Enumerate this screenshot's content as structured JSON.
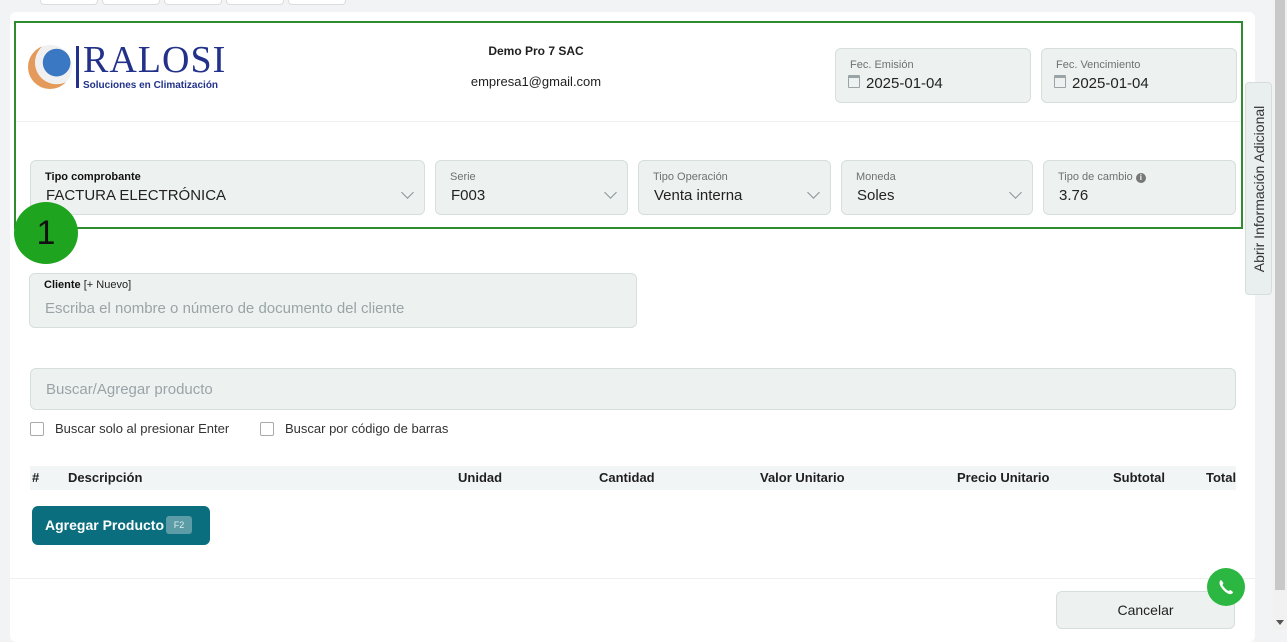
{
  "company": {
    "name": "Demo Pro 7 SAC",
    "email": "empresa1@gmail.com"
  },
  "logo": {
    "name": "RALOSI",
    "tagline": "Soluciones en Climatización"
  },
  "dates": {
    "emission": {
      "label": "Fec. Emisión",
      "value": "2025-01-04"
    },
    "due": {
      "label": "Fec. Vencimiento",
      "value": "2025-01-04"
    }
  },
  "selects": {
    "doc_type": {
      "label": "Tipo comprobante",
      "value": "FACTURA ELECTRÓNICA"
    },
    "series": {
      "label": "Serie",
      "value": "F003"
    },
    "operation": {
      "label": "Tipo Operación",
      "value": "Venta interna"
    },
    "currency": {
      "label": "Moneda",
      "value": "Soles"
    },
    "exchange": {
      "label": "Tipo de cambio",
      "value": "3.76"
    }
  },
  "annotation": {
    "badge": "1"
  },
  "client": {
    "label": "Cliente",
    "new_link": "[+ Nuevo]",
    "placeholder": "Escriba el nombre o número de documento del cliente"
  },
  "product_search": {
    "placeholder": "Buscar/Agregar producto"
  },
  "options": {
    "enter_only": "Buscar solo al presionar Enter",
    "barcode": "Buscar por código de barras"
  },
  "table": {
    "columns": [
      "#",
      "Descripción",
      "Unidad",
      "Cantidad",
      "Valor Unitario",
      "Precio Unitario",
      "Subtotal",
      "Total"
    ]
  },
  "buttons": {
    "add_product": "Agregar Producto",
    "add_product_key": "F2",
    "cancel": "Cancelar"
  },
  "sidebar": {
    "tab_label": "Abrir Información Adicional"
  },
  "colors": {
    "accent": "#0b6e7e",
    "highlight": "#2e8b2e",
    "badge": "#1fa41f",
    "whatsapp": "#2bb741"
  }
}
